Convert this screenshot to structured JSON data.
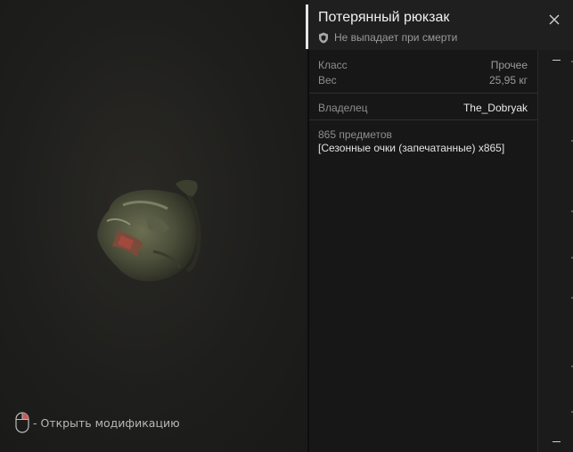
{
  "item": {
    "title": "Потерянный рюкзак",
    "tag": "Не выпадает при смерти"
  },
  "stats": {
    "class_label": "Класс",
    "class_value": "Прочее",
    "weight_label": "Вес",
    "weight_value": "25,95 кг",
    "owner_label": "Владелец",
    "owner_value": "The_Dobryak"
  },
  "contents": {
    "count": "865 предметов",
    "line": "[Сезонные очки (запечатанные) x865]"
  },
  "hint": {
    "text": "- Открыть модификацию"
  },
  "icons": {
    "close": "close-icon",
    "shield": "shield-icon",
    "mouse": "mouse-left-click-icon"
  },
  "colors": {
    "accent": "#e6e6e6",
    "panel_bg": "#171717",
    "preview_bg": "#1e1e1c"
  }
}
